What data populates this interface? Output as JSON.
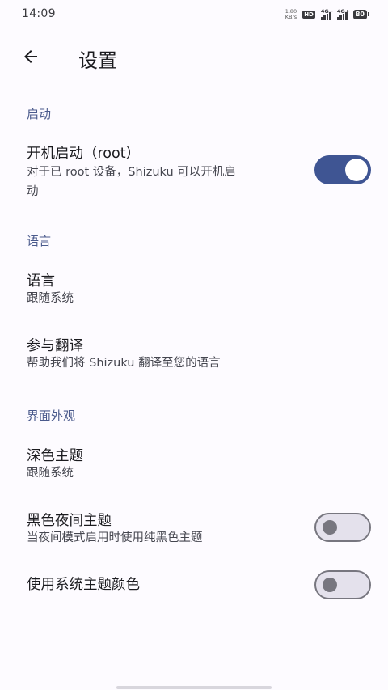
{
  "status_bar": {
    "time": "14:09",
    "net_speed_value": "1.80",
    "net_speed_unit": "KB/s",
    "hd_label": "HD",
    "sim1_label": "4G+",
    "sim2_label": "4G+",
    "battery": "80"
  },
  "app_bar": {
    "title": "设置",
    "back_icon": "arrow-back-icon"
  },
  "sections": {
    "startup": {
      "header": "启动",
      "boot_start": {
        "title": "开机启动（root）",
        "summary_line1": "对于已 root 设备，Shizuku 可以开机启",
        "summary_line2": "动",
        "enabled": true
      }
    },
    "language": {
      "header": "语言",
      "language_pref": {
        "title": "语言",
        "summary": "跟随系统"
      },
      "translate_pref": {
        "title": "参与翻译",
        "summary": "帮助我们将 Shizuku 翻译至您的语言"
      }
    },
    "appearance": {
      "header": "界面外观",
      "dark_theme": {
        "title": "深色主题",
        "summary": "跟随系统"
      },
      "black_night_theme": {
        "title": "黑色夜间主题",
        "summary": "当夜间模式启用时使用纯黑色主题",
        "enabled": false
      },
      "system_colors": {
        "title": "使用系统主题颜色",
        "enabled": false
      }
    }
  },
  "colors": {
    "accent": "#3f5593",
    "section_header": "#4a5a8c",
    "background": "#fdfbff"
  }
}
